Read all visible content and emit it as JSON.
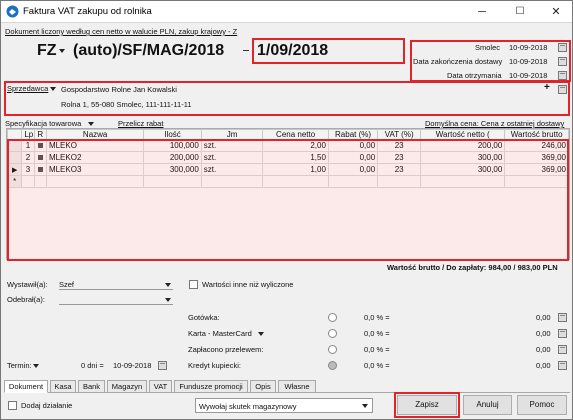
{
  "window": {
    "title": "Faktura VAT zakupu od rolnika",
    "controls": {
      "minimize": "─",
      "maximize": "☐",
      "close": "✕"
    }
  },
  "header": {
    "info_link": "Dokument liczony według cen netto w walucie PLN, zakup krajowy - Z",
    "doc_type": "FZ",
    "doc_number": "(auto)/SF/MAG/2018",
    "doc_date": "1/09/2018",
    "place_label": "Smolec",
    "place_date": "10-09-2018",
    "delivery_label": "Data zakończenia dostawy",
    "delivery_date": "10-09-2018",
    "received_label": "Data otrzymania",
    "received_date": "10-09-2018"
  },
  "seller": {
    "label": "Sprzedawca",
    "name": "Gospodarstwo Rolne Jan Kowalski",
    "address": "Rolna 1, 55-080 Smolec, 111-111-11-11",
    "plus": "+"
  },
  "items_toolbar": {
    "spec_label": "Specyfikacja towarowa",
    "recalc_link": "Przelicz rabat",
    "default_price_link": "Domyślna cena: Cena z ostatniej dostawy"
  },
  "table": {
    "columns": [
      "Lp",
      "R",
      "Nazwa",
      "Ilość",
      "Jm",
      "Cena netto",
      "Rabat (%)",
      "VAT (%)",
      "Wartość netto (",
      "Wartość brutto"
    ],
    "rows": [
      {
        "lp": "1",
        "name": "MLEKO",
        "qty": "100,000",
        "jm": "szt.",
        "price": "2,00",
        "discount": "0,00",
        "vat": "23",
        "net": "200,00",
        "gross": "246,00"
      },
      {
        "lp": "2",
        "name": "MLEKO2",
        "qty": "200,000",
        "jm": "szt.",
        "price": "1,50",
        "discount": "0,00",
        "vat": "23",
        "net": "300,00",
        "gross": "369,00"
      },
      {
        "lp": "3",
        "name": "MLEKO3",
        "qty": "300,000",
        "jm": "szt.",
        "price": "1,00",
        "discount": "0,00",
        "vat": "23",
        "net": "300,00",
        "gross": "369,00"
      }
    ],
    "new_row_marker": "*",
    "current_row_marker": "▶"
  },
  "totals": {
    "gross_text": "Wartość brutto / Do zapłaty: 984,00 / 983,00 PLN"
  },
  "form": {
    "issued_label": "Wystawił(a):",
    "issued_value": "Szef",
    "received_by_label": "Odebrał(a):",
    "received_by_value": "",
    "other_values_label": "Wartości inne niż wyliczone",
    "term_label": "Termin:",
    "term_days": "0 dni =",
    "term_date": "10-09-2018"
  },
  "payments": [
    {
      "label": "Gotówka:",
      "pct": "0,0 % =",
      "amount": "0,00"
    },
    {
      "label": "Karta - MasterCard",
      "pct": "0,0 % =",
      "amount": "0,00"
    },
    {
      "label": "Zapłacono przelewem:",
      "pct": "0,0 % =",
      "amount": "0,00"
    },
    {
      "label": "Kredyt kupiecki:",
      "pct": "0,0 % =",
      "amount": "0,00"
    }
  ],
  "tabs": [
    "Dokument",
    "Kasa",
    "Bank",
    "Magazyn",
    "VAT",
    "Fundusze promocji",
    "Opis",
    "Własne"
  ],
  "footer": {
    "add_action_label": "Dodaj działanie",
    "warehouse_effect": "Wywołaj skutek magazynowy",
    "save": "Zapisz",
    "cancel": "Anuluj",
    "help": "Pomoc"
  },
  "colors": {
    "accent_red": "#e2232a",
    "grid_fill": "#f7e5e5"
  }
}
